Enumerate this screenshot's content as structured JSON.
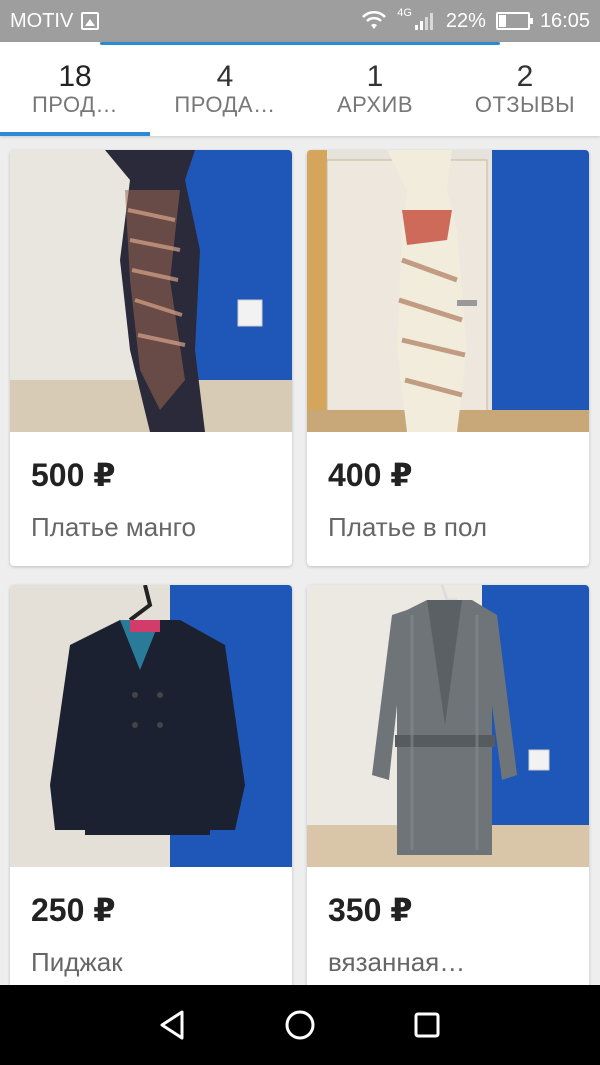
{
  "status_bar": {
    "carrier": "MOTIV",
    "network": "4G",
    "battery": "22%",
    "battery_level": 0.22,
    "time": "16:05"
  },
  "tabs": [
    {
      "count": "18",
      "label": "ПРОД…",
      "active": true
    },
    {
      "count": "4",
      "label": "ПРОДА…",
      "active": false
    },
    {
      "count": "1",
      "label": "АРХИВ",
      "active": false
    },
    {
      "count": "2",
      "label": "ОТЗЫВЫ",
      "active": false
    }
  ],
  "listings": [
    {
      "price": "500 ₽",
      "title": "Платье манго",
      "icon": "dress-photo"
    },
    {
      "price": "400 ₽",
      "title": "Платье в пол",
      "icon": "long-dress-photo"
    },
    {
      "price": "250 ₽",
      "title": "Пиджак",
      "icon": "jacket-photo"
    },
    {
      "price": "350 ₽",
      "title": "вязанная…",
      "icon": "cardigan-photo"
    }
  ],
  "nav": {
    "back": "back-icon",
    "home": "home-icon",
    "recents": "recents-icon"
  },
  "colors": {
    "accent": "#2b8ad6",
    "status_bar": "#9e9e9e",
    "wall_blue": "#1f57b8"
  }
}
